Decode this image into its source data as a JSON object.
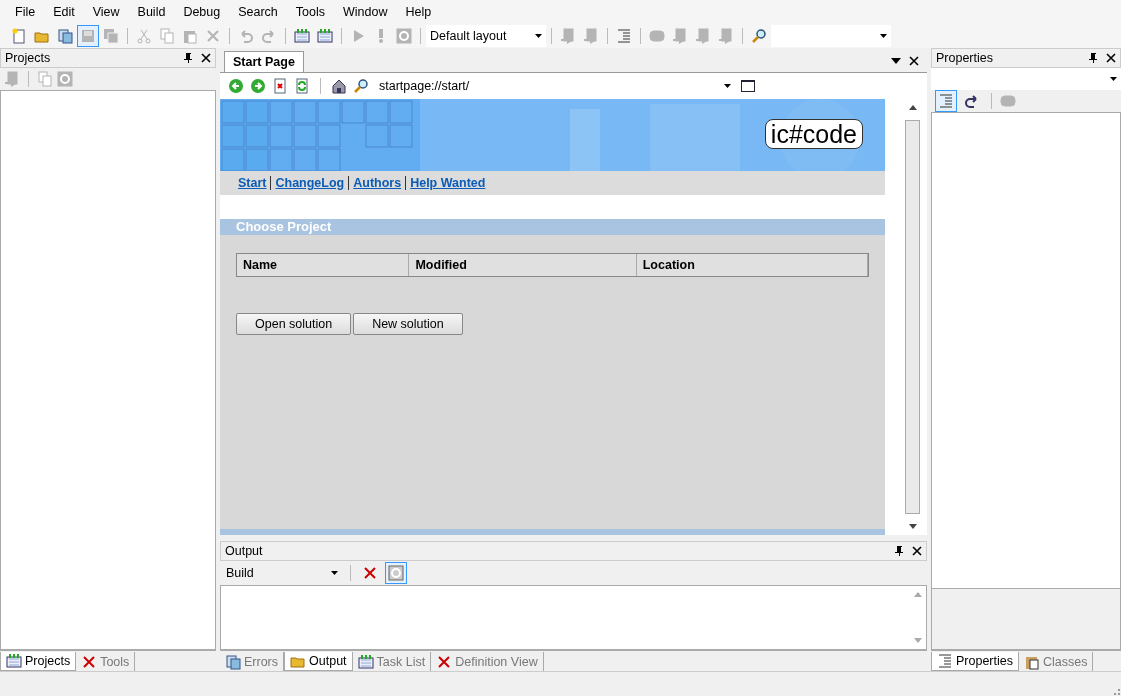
{
  "menu": [
    "File",
    "Edit",
    "View",
    "Build",
    "Debug",
    "Search",
    "Tools",
    "Window",
    "Help"
  ],
  "toolbar": {
    "items": [
      {
        "kind": "new",
        "disabled": false,
        "selected": false
      },
      {
        "kind": "open",
        "disabled": false,
        "selected": false
      },
      {
        "kind": "pages",
        "disabled": false,
        "selected": false
      },
      {
        "kind": "save",
        "disabled": true,
        "selected": true
      },
      {
        "kind": "saveall",
        "disabled": true,
        "selected": false
      },
      {
        "kind": "sep"
      },
      {
        "kind": "cut",
        "disabled": true,
        "selected": false
      },
      {
        "kind": "copy",
        "disabled": true,
        "selected": false
      },
      {
        "kind": "paste",
        "disabled": true,
        "selected": false
      },
      {
        "kind": "delete",
        "disabled": true,
        "selected": false
      },
      {
        "kind": "sep"
      },
      {
        "kind": "undo",
        "disabled": true,
        "selected": false
      },
      {
        "kind": "redo",
        "disabled": true,
        "selected": false
      },
      {
        "kind": "sep"
      },
      {
        "kind": "build",
        "disabled": false,
        "selected": false
      },
      {
        "kind": "build",
        "disabled": false,
        "selected": false
      },
      {
        "kind": "sep"
      },
      {
        "kind": "run",
        "disabled": true,
        "selected": false
      },
      {
        "kind": "exclaim",
        "disabled": true,
        "selected": false
      },
      {
        "kind": "stop",
        "disabled": true,
        "selected": false
      },
      {
        "kind": "sep"
      },
      {
        "kind": "combo",
        "value": "Default layout"
      },
      {
        "kind": "sep"
      },
      {
        "kind": "pagedrop",
        "disabled": true,
        "selected": false
      },
      {
        "kind": "pagearrow",
        "disabled": true,
        "selected": false
      },
      {
        "kind": "sep"
      },
      {
        "kind": "lines",
        "disabled": false,
        "selected": false
      },
      {
        "kind": "sep"
      },
      {
        "kind": "rounded",
        "disabled": true,
        "selected": false
      },
      {
        "kind": "pagearrow",
        "disabled": true,
        "selected": false
      },
      {
        "kind": "pagearrow",
        "disabled": true,
        "selected": false
      },
      {
        "kind": "pagearrow",
        "disabled": true,
        "selected": false
      },
      {
        "kind": "sep"
      },
      {
        "kind": "find",
        "disabled": false,
        "selected": false
      },
      {
        "kind": "combo",
        "value": ""
      }
    ]
  },
  "projects_panel": {
    "title": "Projects",
    "tabs": [
      {
        "label": "Projects",
        "selected": true
      },
      {
        "label": "Tools",
        "selected": false
      }
    ]
  },
  "document": {
    "tab": "Start Page",
    "address": "startpage://start/",
    "page": {
      "logo": "ic#code",
      "links": [
        "Start",
        "ChangeLog",
        "Authors",
        "Help Wanted"
      ],
      "section": "Choose Project",
      "columns": [
        "Name",
        "Modified",
        "Location"
      ],
      "buttons": [
        "Open solution",
        "New solution"
      ]
    }
  },
  "output_panel": {
    "title": "Output",
    "source": "Build",
    "wrap_selected": true,
    "tabs": [
      {
        "label": "Errors",
        "selected": false
      },
      {
        "label": "Output",
        "selected": true
      },
      {
        "label": "Task List",
        "selected": false
      },
      {
        "label": "Definition View",
        "selected": false
      }
    ]
  },
  "properties_panel": {
    "title": "Properties",
    "categorized_selected": true,
    "tabs": [
      {
        "label": "Properties",
        "selected": true
      },
      {
        "label": "Classes",
        "selected": false
      }
    ]
  }
}
